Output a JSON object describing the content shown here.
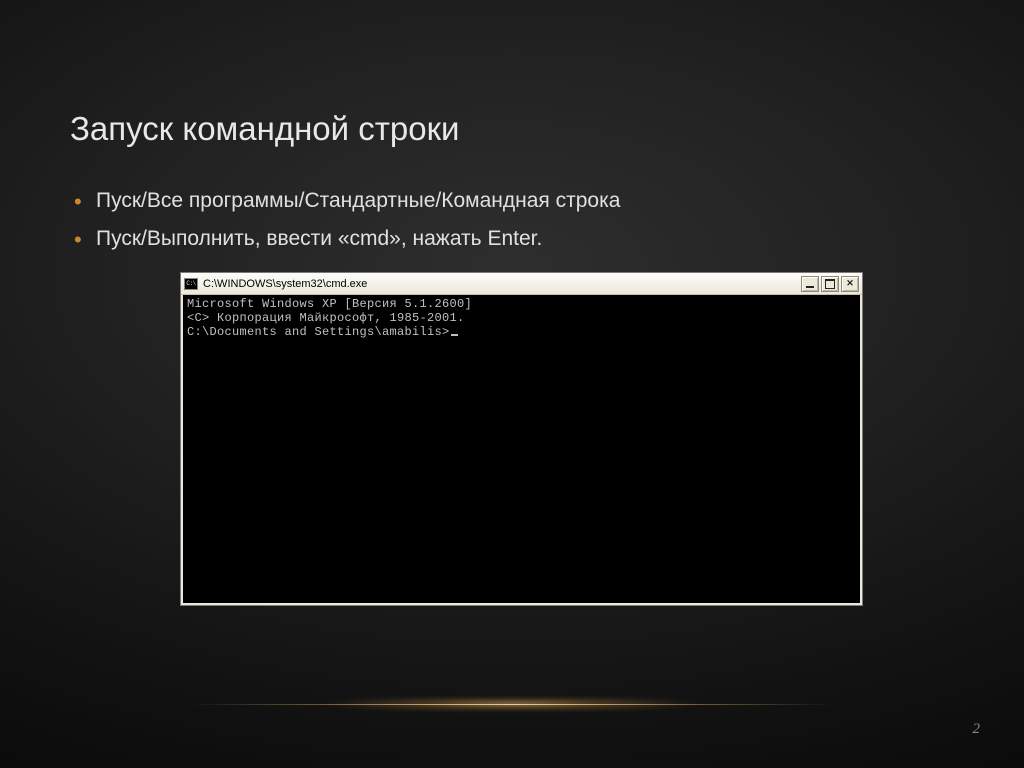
{
  "slide": {
    "title": "Запуск командной строки",
    "bullets": [
      "Пуск/Все программы/Стандартные/Командная строка",
      "Пуск/Выполнить, ввести «cmd», нажать Enter."
    ],
    "page_number": "2"
  },
  "cmd": {
    "title": "C:\\WINDOWS\\system32\\cmd.exe",
    "lines": {
      "l1": "Microsoft Windows XP [Версия 5.1.2600]",
      "l2": "<С> Корпорация Майкрософт, 1985-2001.",
      "l3": "",
      "l4": "C:\\Documents and Settings\\amabilis>"
    }
  }
}
